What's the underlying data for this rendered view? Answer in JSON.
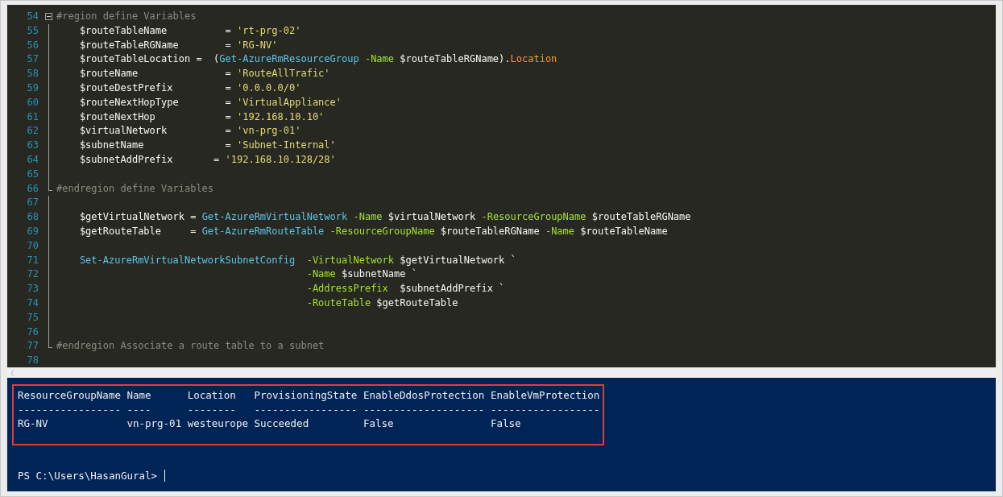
{
  "editor": {
    "lines": [
      {
        "number": "54",
        "kind": "opener",
        "tokens": [
          {
            "kind": "comment",
            "text": "#region define Variables"
          }
        ]
      },
      {
        "number": "55",
        "tokens": [
          {
            "kind": "plain",
            "text": "    $routeTableName          = "
          },
          {
            "kind": "string",
            "text": "'rt-prg-02'"
          }
        ]
      },
      {
        "number": "56",
        "tokens": [
          {
            "kind": "plain",
            "text": "    $routeTableRGName        = "
          },
          {
            "kind": "string",
            "text": "'RG-NV'"
          }
        ]
      },
      {
        "number": "57",
        "tokens": [
          {
            "kind": "plain",
            "text": "    $routeTableLocation =  ("
          },
          {
            "kind": "command",
            "text": "Get-AzureRmResourceGroup"
          },
          {
            "kind": "parameter",
            "text": " -Name"
          },
          {
            "kind": "plain",
            "text": " $routeTableRGName)."
          },
          {
            "kind": "property",
            "text": "Location"
          }
        ]
      },
      {
        "number": "58",
        "tokens": [
          {
            "kind": "plain",
            "text": "    $routeName               = "
          },
          {
            "kind": "string",
            "text": "'RouteAllTrafic'"
          }
        ]
      },
      {
        "number": "59",
        "tokens": [
          {
            "kind": "plain",
            "text": "    $routeDestPrefix         = "
          },
          {
            "kind": "string",
            "text": "'0.0.0.0/0'"
          }
        ]
      },
      {
        "number": "60",
        "tokens": [
          {
            "kind": "plain",
            "text": "    $routeNextHopType        = "
          },
          {
            "kind": "string",
            "text": "'VirtualAppliance'"
          }
        ]
      },
      {
        "number": "61",
        "tokens": [
          {
            "kind": "plain",
            "text": "    $routeNextHop            = "
          },
          {
            "kind": "string",
            "text": "'192.168.10.10'"
          }
        ]
      },
      {
        "number": "62",
        "tokens": [
          {
            "kind": "plain",
            "text": "    $virtualNetwork          = "
          },
          {
            "kind": "string",
            "text": "'vn-prg-01'"
          }
        ]
      },
      {
        "number": "63",
        "tokens": [
          {
            "kind": "plain",
            "text": "    $subnetName              = "
          },
          {
            "kind": "string",
            "text": "'Subnet-Internal'"
          }
        ]
      },
      {
        "number": "64",
        "tokens": [
          {
            "kind": "plain",
            "text": "    $subnetAddPrefix       = "
          },
          {
            "kind": "string",
            "text": "'192.168.10.128/28'"
          }
        ]
      },
      {
        "number": "65"
      },
      {
        "number": "66",
        "kind": "closer",
        "tokens": [
          {
            "kind": "comment",
            "text": "#endregion define Variables"
          }
        ]
      },
      {
        "number": "67"
      },
      {
        "number": "68",
        "tokens": [
          {
            "kind": "plain",
            "text": "    $getVirtualNetwork = "
          },
          {
            "kind": "command",
            "text": "Get-AzureRmVirtualNetwork"
          },
          {
            "kind": "parameter",
            "text": " -Name"
          },
          {
            "kind": "plain",
            "text": " $virtualNetwork "
          },
          {
            "kind": "parameter",
            "text": "-ResourceGroupName"
          },
          {
            "kind": "plain",
            "text": " $routeTableRGName"
          }
        ]
      },
      {
        "number": "69",
        "tokens": [
          {
            "kind": "plain",
            "text": "    $getRouteTable     = "
          },
          {
            "kind": "command",
            "text": "Get-AzureRmRouteTable"
          },
          {
            "kind": "parameter",
            "text": " -ResourceGroupName"
          },
          {
            "kind": "plain",
            "text": " $routeTableRGName "
          },
          {
            "kind": "parameter",
            "text": "-Name"
          },
          {
            "kind": "plain",
            "text": " $routeTableName"
          }
        ]
      },
      {
        "number": "70"
      },
      {
        "number": "71",
        "tokens": [
          {
            "kind": "command",
            "text": "    Set-AzureRmVirtualNetworkSubnetConfig"
          },
          {
            "kind": "parameter",
            "text": "  -VirtualNetwork"
          },
          {
            "kind": "plain",
            "text": " $getVirtualNetwork `"
          }
        ]
      },
      {
        "number": "72",
        "tokens": [
          {
            "kind": "parameter",
            "text": "                                           -Name"
          },
          {
            "kind": "plain",
            "text": " $subnetName `"
          }
        ]
      },
      {
        "number": "73",
        "tokens": [
          {
            "kind": "parameter",
            "text": "                                           -AddressPrefix"
          },
          {
            "kind": "plain",
            "text": "  $subnetAddPrefix `"
          }
        ]
      },
      {
        "number": "74",
        "tokens": [
          {
            "kind": "parameter",
            "text": "                                           -RouteTable"
          },
          {
            "kind": "plain",
            "text": " $getRouteTable"
          }
        ]
      },
      {
        "number": "75"
      },
      {
        "number": "76"
      },
      {
        "number": "77",
        "kind": "closer",
        "tokens": [
          {
            "kind": "comment",
            "text": "#endregion Associate a route table to a subnet"
          }
        ]
      },
      {
        "number": "78"
      }
    ]
  },
  "terminal": {
    "table": {
      "columns": [
        {
          "header": "ResourceGroupName",
          "rule": "-----------------",
          "value": "RG-NV"
        },
        {
          "header": "Name",
          "rule": "----",
          "value": "vn-prg-01"
        },
        {
          "header": "Location",
          "rule": "--------",
          "value": "westeurope"
        },
        {
          "header": "ProvisioningState",
          "rule": "-----------------",
          "value": "Succeeded"
        },
        {
          "header": "EnableDdosProtection",
          "rule": "--------------------",
          "value": "False"
        },
        {
          "header": "EnableVmProtection",
          "rule": "------------------",
          "value": "False"
        }
      ]
    },
    "prompt": "PS C:\\Users\\HasanGural>"
  }
}
